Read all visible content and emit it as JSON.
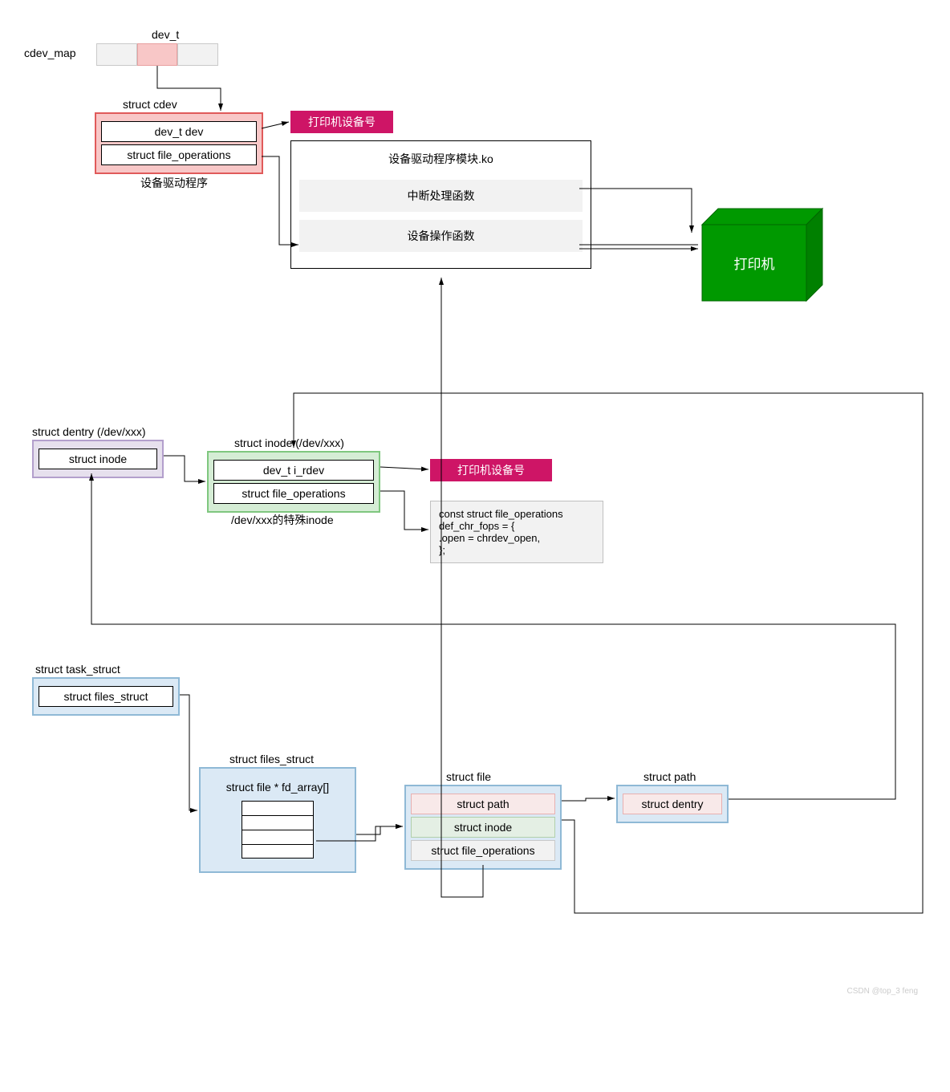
{
  "top": {
    "cdev_map_label": "cdev_map",
    "dev_t_label": "dev_t",
    "struct_cdev_title": "struct cdev",
    "struct_cdev_caption": "设备驱动程序",
    "cdev_f1": "dev_t dev",
    "cdev_f2": "struct file_operations",
    "printer_dev_num": "打印机设备号",
    "ko_title": "设备驱动程序模块.ko",
    "ko_irq": "中断处理函数",
    "ko_ops": "设备操作函数",
    "printer": "打印机"
  },
  "mid": {
    "dentry_title": "struct dentry (/dev/xxx)",
    "dentry_f1": "struct inode",
    "inode_title": "struct inode (/dev/xxx)",
    "inode_caption": "/dev/xxx的特殊inode",
    "inode_f1": "dev_t i_rdev",
    "inode_f2": "struct file_operations",
    "printer_dev_num2": "打印机设备号",
    "code": "const struct file_operations\ndef_chr_fops = {\n.open = chrdev_open,\n};"
  },
  "bot": {
    "task_title": "struct task_struct",
    "task_f1": "struct files_struct",
    "files_title": "struct files_struct",
    "files_f1": "struct file * fd_array[]",
    "file_title": "struct file",
    "file_f1": "struct path",
    "file_f2": "struct inode",
    "file_f3": "struct file_operations",
    "path_title": "struct path",
    "path_f1": "struct dentry"
  },
  "watermark": "CSDN @top_3 feng"
}
